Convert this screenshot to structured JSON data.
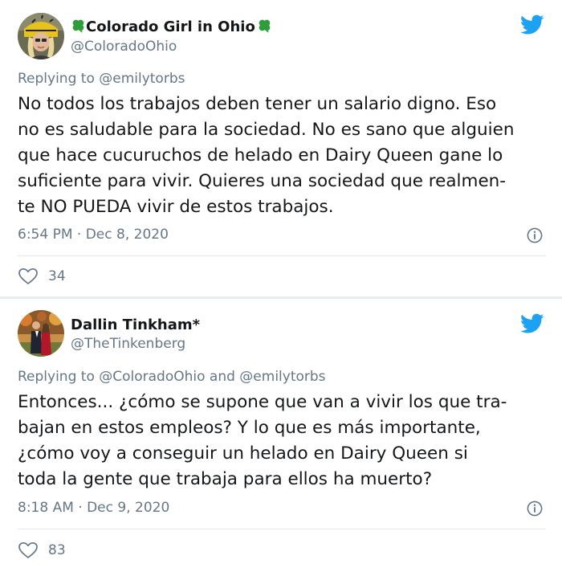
{
  "colors": {
    "twitter_blue": "#1da1f2",
    "secondary_text": "#657786",
    "clover_green": "#2e9d3a"
  },
  "tweets": [
    {
      "author": {
        "name": "Colorado Girl in Ohio",
        "handle": "@ColoradoOhio",
        "name_decoration_icon": "four-leaf-clover-icon"
      },
      "replying_to": "Replying to @emilytorbs",
      "body_lines": [
        "No todos los trabajos deben tener un salario digno. Eso",
        "no es saludable para la sociedad. No es sano que alguien",
        "que hace cucuruchos de helado en Dairy Queen gane lo",
        "suficiente para vivir. Quieres una sociedad que realmen-",
        "te NO PUEDA vivir de estos trabajos."
      ],
      "timestamp": "6:54 PM · Dec 8, 2020",
      "likes": "34"
    },
    {
      "author": {
        "name": "Dallin Tinkham*",
        "handle": "@TheTinkenberg"
      },
      "replying_to": "Replying to @ColoradoOhio and @emilytorbs",
      "body_lines": [
        "Entonces... ¿cómo se supone que van a vivir los que tra-",
        "bajan en estos empleos? Y lo que es más importante,",
        "¿cómo voy a conseguir un helado en Dairy Queen si",
        "toda la gente que trabaja para ellos ha muerto?"
      ],
      "timestamp": "8:18 AM · Dec 9, 2020",
      "likes": "83"
    }
  ]
}
